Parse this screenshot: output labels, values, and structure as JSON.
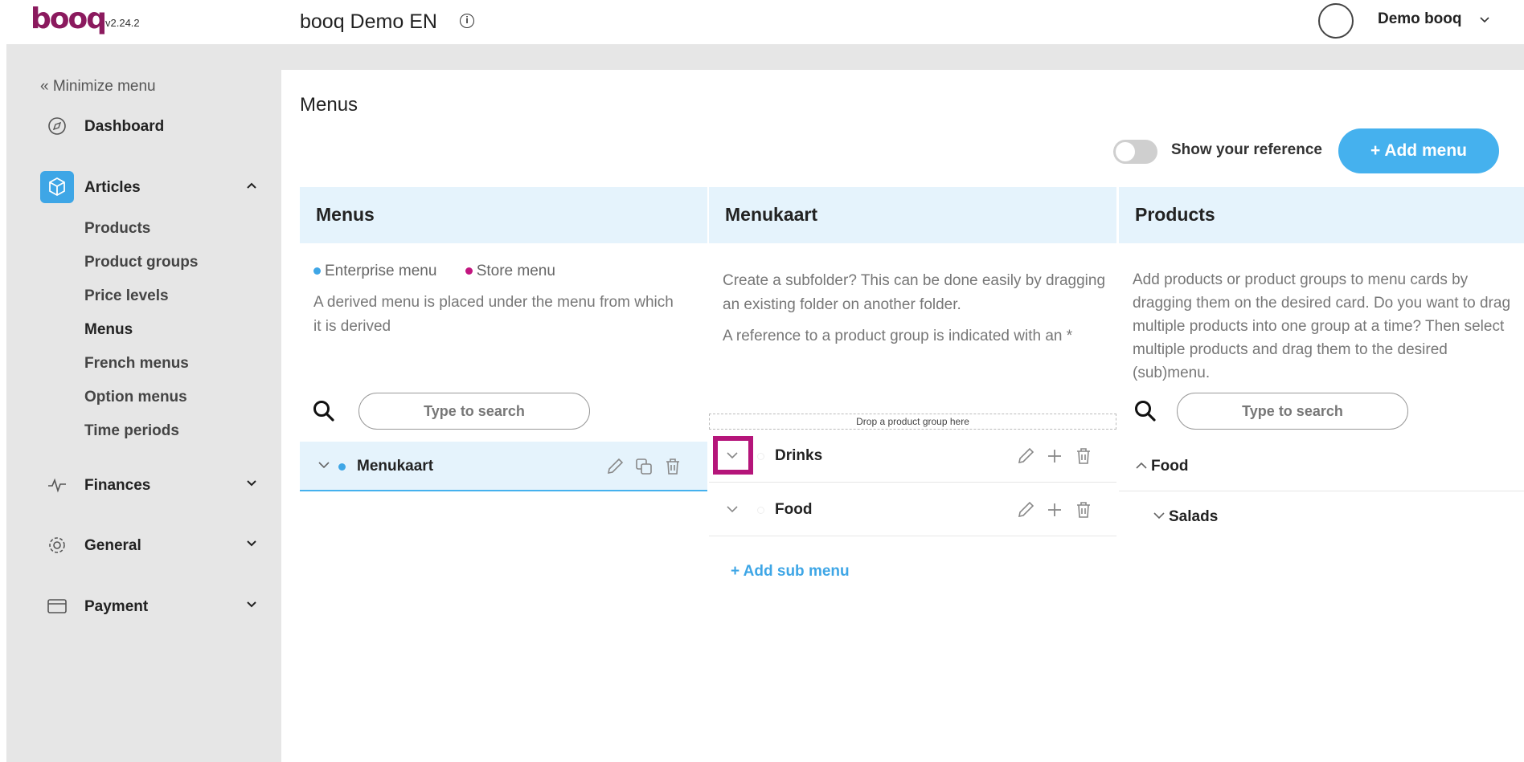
{
  "app": {
    "logo": "booq",
    "version": "v2.24.2",
    "store_title": "booq Demo EN",
    "user_name": "Demo booq"
  },
  "sidebar": {
    "minimize_label": "« Minimize menu",
    "dashboard": "Dashboard",
    "articles": "Articles",
    "articles_sub": [
      "Products",
      "Product groups",
      "Price levels",
      "Menus",
      "French menus",
      "Option menus",
      "Time periods"
    ],
    "finances": "Finances",
    "general": "General",
    "payment": "Payment"
  },
  "page": {
    "title": "Menus",
    "show_reference_label": "Show your reference",
    "add_menu_label": "+ Add menu"
  },
  "menus_col": {
    "header": "Menus",
    "legend_enterprise": "Enterprise menu",
    "legend_store": "Store menu",
    "description": "A derived menu is placed under the menu from which it is derived",
    "search_placeholder": "Type to search",
    "items": [
      {
        "label": "Menukaart"
      }
    ]
  },
  "menukaart_col": {
    "header": "Menukaart",
    "description_1": "Create a subfolder? This can be done easily by dragging an existing folder on another folder.",
    "description_2": "A reference to a product group is indicated with an *",
    "drop_zone": "Drop a product group here",
    "items": [
      {
        "label": "Drinks"
      },
      {
        "label": "Food"
      }
    ],
    "add_sub_menu": "+ Add sub menu"
  },
  "products_col": {
    "header": "Products",
    "description": "Add products or product groups to menu cards by dragging them on the desired card. Do you want to drag multiple products into one group at a time? Then select multiple products and drag them to the desired (sub)menu.",
    "search_placeholder": "Type to search",
    "groups": [
      {
        "label": "Food"
      },
      {
        "label": "Salads"
      }
    ]
  },
  "colors": {
    "brand": "#8b1a5e",
    "accent": "#45b1ee",
    "enterprise_dot": "#3ea6e6",
    "store_dot": "#c2157f",
    "highlight": "#b5157a"
  }
}
